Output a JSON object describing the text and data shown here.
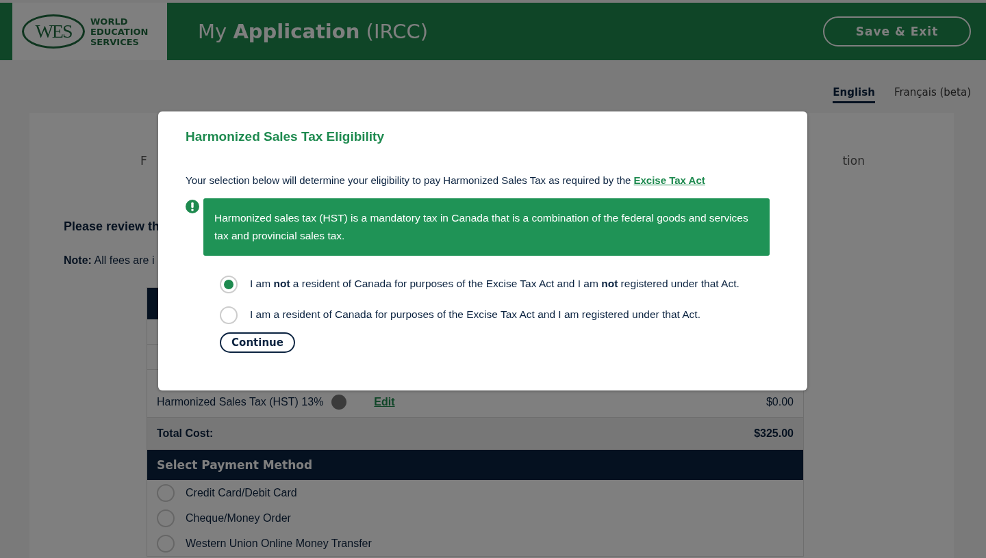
{
  "header": {
    "logo_mark": "WES",
    "logo_lines": [
      "WORLD",
      "EDUCATION",
      "SERVICES"
    ],
    "title_prefix": "My",
    "title_main": "Application",
    "title_suffix": "(IRCC)",
    "save_button": "Save & Exit"
  },
  "languages": [
    {
      "label": "English",
      "selected": true
    },
    {
      "label": "Français (beta)",
      "selected": false
    }
  ],
  "steps": [
    "F",
    "tion"
  ],
  "review": {
    "heading": "Please review th",
    "note": "**Note:** All fees are i"
  },
  "fees": {
    "rows": [
      {
        "label": "Harmonized Sales Tax (HST) 13%",
        "link": "Edit",
        "amount": "$0.00"
      }
    ],
    "total_label": "Total Cost:",
    "total": "$325.00"
  },
  "payment": {
    "title": "Select Payment Method",
    "options": [
      {
        "label": "Credit Card/Debit Card",
        "selected": false
      },
      {
        "label": "Cheque/Money Order",
        "selected": false
      },
      {
        "label": "Western Union Online Money Transfer",
        "selected": false
      }
    ]
  },
  "modal": {
    "title": "Harmonized Sales Tax Eligibility",
    "intro": "Your selection below will determine your eligibility to pay Harmonized Sales Tax as required by the",
    "intro_link": "Excise Tax Act",
    "alert": "Harmonized sales tax (HST) is a mandatory tax in Canada that is a combination of the federal goods and services tax and provincial sales tax.",
    "options": [
      {
        "label": "I am **not** a resident of Canada for purposes of the Excise Tax Act and I am **not** registered under that Act.",
        "selected": true
      },
      {
        "label": "I am a resident of Canada for purposes of the Excise Tax Act and I am registered under that Act.",
        "selected": false
      }
    ],
    "button": "Continue"
  }
}
